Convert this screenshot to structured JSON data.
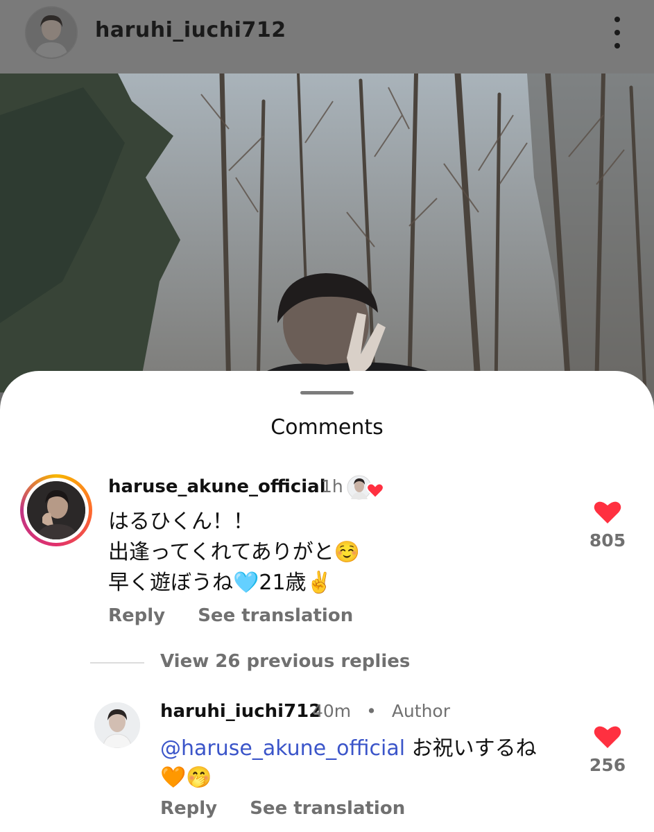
{
  "header": {
    "username": "haruhi_iuchi712",
    "more_icon": "more-vertical-icon"
  },
  "sheet": {
    "title": "Comments"
  },
  "comment": {
    "username": "haruse_akune_official",
    "time": "1h",
    "text_line1": "はるひくん！！",
    "text_line2": "出逢ってくれてありがと",
    "text_line2_emoji": "☺️",
    "text_line3_a": "早く遊ぼうね",
    "text_line3_emoji1": "🩵",
    "text_line3_b": "21歳",
    "text_line3_emoji2": "✌️",
    "reply_label": "Reply",
    "translate_label": "See translation",
    "like_count": "805"
  },
  "view_replies": "View 26 previous replies",
  "reply": {
    "username": "haruhi_iuchi712",
    "time": "40m",
    "separator": "•",
    "badge": "Author",
    "mention": "@haruse_akune_official",
    "text": " お祝いするね",
    "emojis": "🧡🤭",
    "reply_label": "Reply",
    "translate_label": "See translation",
    "like_count": "256"
  },
  "colors": {
    "like_red": "#ff3040",
    "mention_blue": "#3b55c9",
    "secondary_text": "#707070"
  }
}
